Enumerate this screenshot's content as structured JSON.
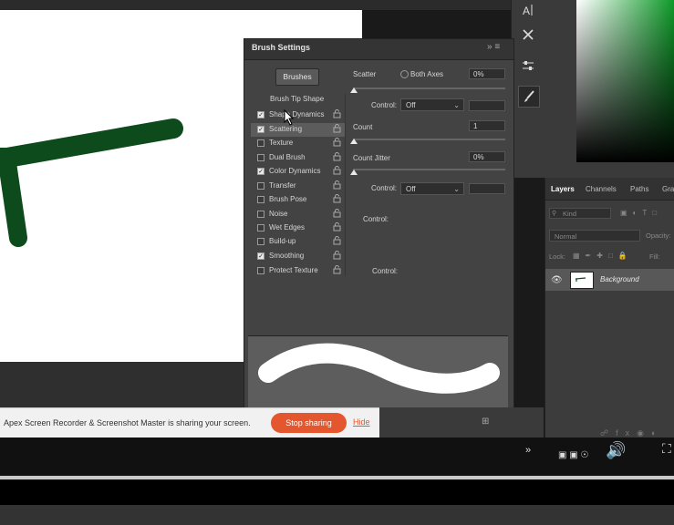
{
  "brush_settings": {
    "title": "Brush Settings",
    "brushes_button": "Brushes",
    "tip_shape_label": "Brush Tip Shape",
    "options": [
      {
        "label": "Shape Dynamics",
        "checked": true
      },
      {
        "label": "Scattering",
        "checked": true
      },
      {
        "label": "Texture",
        "checked": false
      },
      {
        "label": "Dual Brush",
        "checked": false
      },
      {
        "label": "Color Dynamics",
        "checked": true
      },
      {
        "label": "Transfer",
        "checked": false
      },
      {
        "label": "Brush Pose",
        "checked": false
      },
      {
        "label": "Noise",
        "checked": false
      },
      {
        "label": "Wet Edges",
        "checked": false
      },
      {
        "label": "Build-up",
        "checked": false
      },
      {
        "label": "Smoothing",
        "checked": true
      },
      {
        "label": "Protect Texture",
        "checked": false
      }
    ],
    "scatter_label": "Scatter",
    "both_axes_label": "Both Axes",
    "scatter_value": "0%",
    "control_label": "Control:",
    "control_value": "Off",
    "count_label": "Count",
    "count_value": "1",
    "count_jitter_label": "Count Jitter",
    "count_jitter_value": "0%"
  },
  "layers": {
    "tabs": [
      "Layers",
      "Channels",
      "Paths",
      "Gra"
    ],
    "kind_placeholder": "Kind",
    "blend_mode": "Normal",
    "opacity_label": "Opacity:",
    "lock_label": "Lock:",
    "fill_label": "Fill:",
    "layer_name": "Background"
  },
  "share_bar": {
    "message": "Apex Screen Recorder & Screenshot Master is sharing your screen.",
    "stop_label": "Stop sharing",
    "hide_label": "Hide"
  },
  "colors": {
    "stroke": "#0d4a1c",
    "accent": "#e4572e",
    "picker_hue": "#0f9a2a"
  }
}
